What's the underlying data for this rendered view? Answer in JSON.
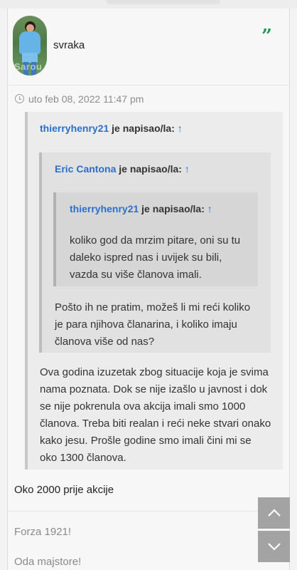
{
  "post": {
    "username": "svraka",
    "avatar_watermark": "Sarou",
    "timestamp": "uto feb 08, 2022 11:47 pm",
    "quote_icon": "quote-icon",
    "clock_icon": "clock-icon"
  },
  "quotes": {
    "outer": {
      "author": "thierryhenry21",
      "wrote": "je napisao/la:",
      "arrow": "↑",
      "lines": [
        "Ova godina izuzetak zbog situacije koja je svima",
        "nama poznata. Dok se nije izašlo u javnost i dok",
        "se nije pokrenula ova akcija imali smo 1000",
        "članova. Treba biti realan i reći neke stvari onako",
        "kako jesu. Prošle godine smo imali čini mi se",
        "oko 1300 članova."
      ]
    },
    "middle": {
      "author": "Eric Cantona",
      "wrote": "je napisao/la:",
      "arrow": "↑",
      "lines": [
        "Pošto ih ne pratim, možeš li mi reći koliko",
        "je para njihova članarina, i koliko imaju",
        "članova više od nas?"
      ]
    },
    "inner": {
      "author": "thierryhenry21",
      "wrote": "je napisao/la:",
      "arrow": "↑",
      "lines": [
        "koliko god da mrzim pitare, oni su tu",
        "daleko ispred nas i uvijek su bili,",
        "vazda su više članova imali."
      ]
    }
  },
  "body_text": "Oko 2000 prije akcije",
  "signature": {
    "line1": "Forza 1921!",
    "line2": "Oda majstore!"
  },
  "controls": {
    "scroll_up_icon": "chevron-up-icon",
    "scroll_down_icon": "chevron-down-icon"
  }
}
